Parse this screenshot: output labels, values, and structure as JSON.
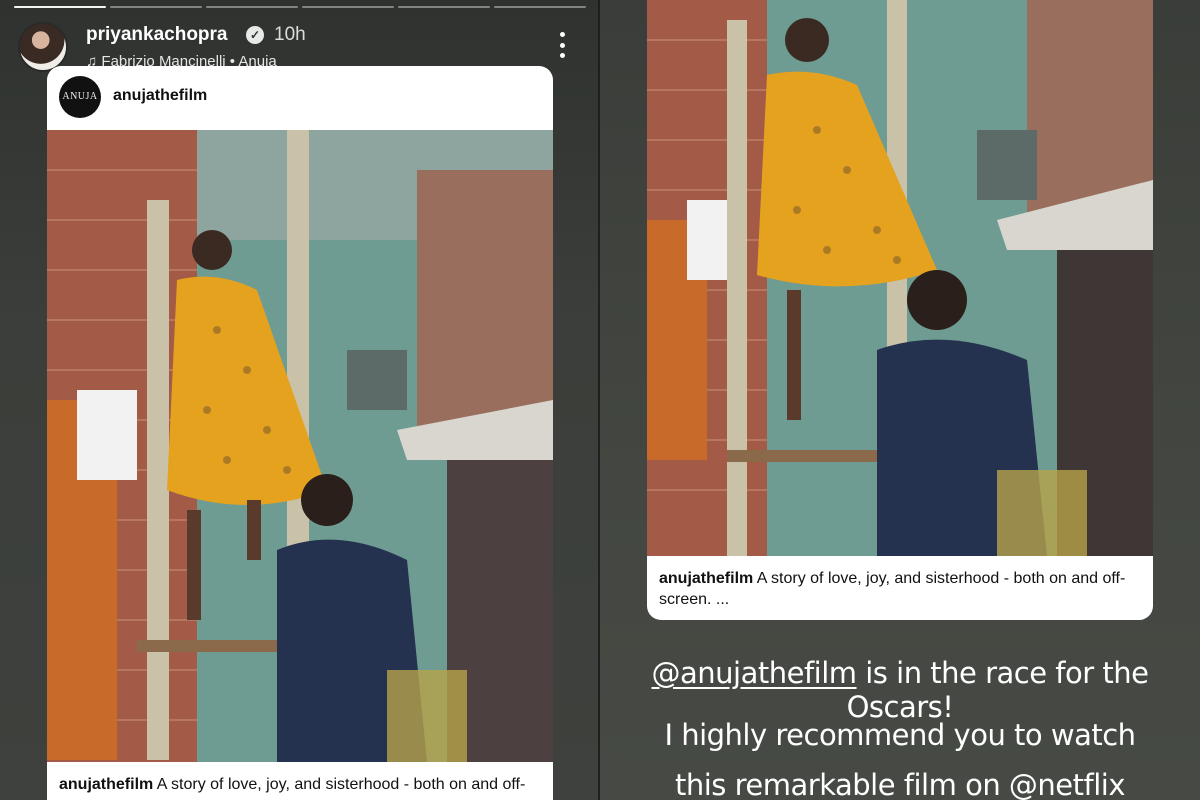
{
  "story": {
    "username": "priyankachopra",
    "verified_glyph": "✓",
    "time": "10h",
    "music_glyph": "♫",
    "music": "Fabrizio Mancinelli • Anuja",
    "progress_segments": 6,
    "progress_done": 1
  },
  "shared_post": {
    "account": "anujathefilm",
    "logo_text": "ANUJA",
    "caption_user": "anujathefilm",
    "caption_left": "A story of love, joy, and sisterhood - both on and off-screen.",
    "caption_right": "A story of love, joy, and sisterhood - both on and off-screen. ..."
  },
  "overlay_text": {
    "mention": "@anujathefilm",
    "line1_rest": " is in the race for the Oscars!",
    "line2": "I highly recommend you to watch",
    "line3": "this remarkable film on @netflix"
  },
  "icons": [
    "verified-icon",
    "music-icon",
    "more-options-icon"
  ],
  "colors": {
    "overlay_bg": "#3e413d",
    "card_bg": "#ffffff",
    "dress": "#e5a21f",
    "wall": "#6fa59b"
  }
}
